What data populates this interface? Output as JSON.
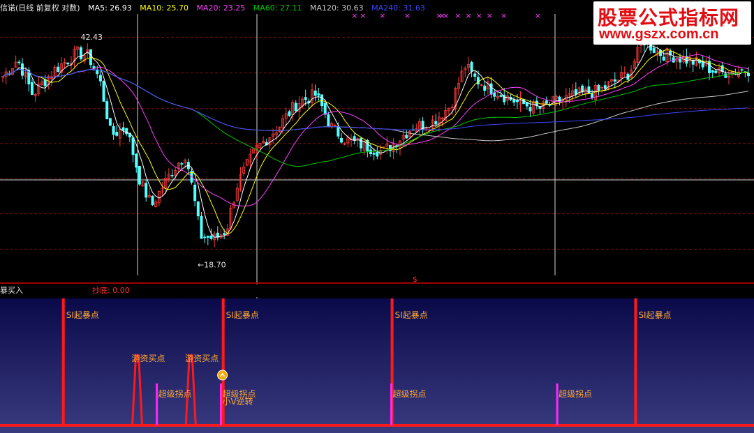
{
  "legend": {
    "title": "信诺(日线 前复权 对数)",
    "ma5": "MA5: 26.93",
    "ma10": "MA10: 25.70",
    "ma20": "MA20: 23.25",
    "ma60": "MA60: 27.11",
    "ma120": "MA120: 30.63",
    "ma240": "MA240: 31.63"
  },
  "colors": {
    "up": "#ff3b3b",
    "down": "#53ffff",
    "ma5": "#ffffff",
    "ma10": "#ffff00",
    "ma20": "#ff40ff",
    "ma60": "#00c800",
    "ma120": "#c8c8c8",
    "ma240": "#3c46ff",
    "signal_red": "#ff1a1a",
    "signal_magenta": "#ff28ff",
    "label_orange": "#ffaa33",
    "subpanel_bg_top": "#0a0a4a",
    "subpanel_bg_bottom": "#3a3a80"
  },
  "watermark": {
    "line1": "股票公式指标网",
    "line2": "www.gszx.com.cn"
  },
  "sub_indicator": {
    "name": "暴买入",
    "value": "抄底: 0.00"
  },
  "chart_data": [
    {
      "type": "candlestick",
      "title": "信诺(日线 前复权 对数)",
      "ylim": [
        17.2,
        47.5
      ],
      "annotations": [
        {
          "label": "42.43",
          "text": "42.43",
          "x": 0.107,
          "y": 42.43
        },
        {
          "label": "18.70",
          "text": "←18.70",
          "x": 0.262,
          "y": 18.7
        },
        {
          "label": "dollar",
          "text": "$",
          "x": 0.547
        }
      ],
      "x_markers": [
        {
          "symbol": "×",
          "x": [
            0.466,
            0.477,
            0.503,
            0.536,
            0.578,
            0.582,
            0.587,
            0.603,
            0.617,
            0.631,
            0.645,
            0.664,
            0.709
          ]
        }
      ],
      "moving_averages": [
        {
          "name": "MA5",
          "value": 26.93
        },
        {
          "name": "MA10",
          "value": 25.7
        },
        {
          "name": "MA20",
          "value": 23.25
        },
        {
          "name": "MA60",
          "value": 27.11
        },
        {
          "name": "MA120",
          "value": 30.63
        },
        {
          "name": "MA240",
          "value": 31.63
        }
      ],
      "close_path": [
        [
          0.0,
          37.5
        ],
        [
          0.02,
          40
        ],
        [
          0.04,
          35
        ],
        [
          0.07,
          38.5
        ],
        [
          0.1,
          41
        ],
        [
          0.115,
          40.5
        ],
        [
          0.13,
          37
        ],
        [
          0.145,
          30
        ],
        [
          0.165,
          31
        ],
        [
          0.185,
          25
        ],
        [
          0.2,
          23
        ],
        [
          0.225,
          26
        ],
        [
          0.245,
          28
        ],
        [
          0.265,
          20.5
        ],
        [
          0.285,
          20.3
        ],
        [
          0.3,
          21
        ],
        [
          0.315,
          25
        ],
        [
          0.34,
          28.5
        ],
        [
          0.37,
          31
        ],
        [
          0.395,
          34
        ],
        [
          0.42,
          35
        ],
        [
          0.44,
          31
        ],
        [
          0.46,
          29.5
        ],
        [
          0.48,
          29
        ],
        [
          0.51,
          28.2
        ],
        [
          0.53,
          29.5
        ],
        [
          0.55,
          31
        ],
        [
          0.575,
          31.5
        ],
        [
          0.6,
          33.5
        ],
        [
          0.62,
          39
        ],
        [
          0.635,
          37
        ],
        [
          0.66,
          35.5
        ],
        [
          0.69,
          34
        ],
        [
          0.72,
          33.2
        ],
        [
          0.74,
          34
        ],
        [
          0.77,
          35
        ],
        [
          0.8,
          35.5
        ],
        [
          0.84,
          38
        ],
        [
          0.86,
          43
        ],
        [
          0.88,
          41
        ],
        [
          0.9,
          40.5
        ],
        [
          0.93,
          39.5
        ],
        [
          0.96,
          38
        ],
        [
          1.0,
          38.5
        ]
      ]
    },
    {
      "type": "bar",
      "title": "暴买入",
      "ylim": [
        0,
        1
      ],
      "labels": {
        "si": "SI起暴点",
        "youzi": "游资买点",
        "chaoji": "超级拐点",
        "vni": "小V逆转",
        "youzi_overlap": "游资买点"
      },
      "series": [
        {
          "name": "SI起暴点",
          "color_key": "signal_red",
          "x": [
            0.084,
            0.296,
            0.52,
            0.843
          ],
          "values": [
            1,
            1,
            1,
            1
          ]
        },
        {
          "name": "超级拐点",
          "color_key": "signal_magenta",
          "x": [
            0.208,
            0.293,
            0.519,
            0.739
          ],
          "values": [
            0.33,
            0.33,
            0.33,
            0.33
          ]
        },
        {
          "name": "游资买点",
          "color_key": "signal_red",
          "x": [
            0.182,
            0.253
          ],
          "values": [
            0.55,
            0.55
          ],
          "shape": "spike"
        }
      ],
      "annotations": [
        {
          "text": "SI起暴点",
          "x": [
            0.084,
            0.296,
            0.52,
            0.843
          ]
        },
        {
          "text": "游资买点",
          "x": [
            0.18,
            0.253
          ]
        },
        {
          "text": "超级拐点",
          "x": [
            0.208,
            0.293,
            0.519,
            0.739
          ]
        },
        {
          "text": "小V逆转",
          "x": 0.293
        }
      ]
    }
  ]
}
